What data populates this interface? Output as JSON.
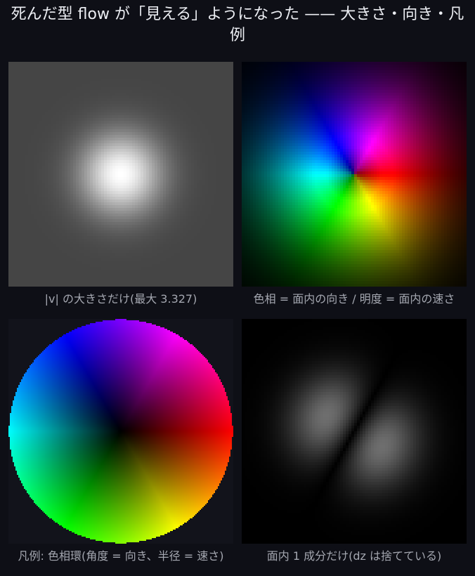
{
  "title": "死んだ型 flow が「見える」ようになった —— 大きさ・向き・凡例",
  "panels": [
    {
      "id": "magnitude",
      "image": "grayscale speed magnitude map of a centered vortex",
      "caption": "|v| の大きさだけ(最大 3.327)",
      "max_speed": 3.327
    },
    {
      "id": "hsv-flow",
      "image": "hue = in-plane direction, brightness = in-plane speed",
      "caption": "色相 = 面内の向き / 明度 = 面内の速さ"
    },
    {
      "id": "legend-wheel",
      "image": "hue wheel legend",
      "caption": "凡例: 色相環(角度 = 向き、半径 = 速さ)"
    },
    {
      "id": "single-component",
      "image": "grayscale single in-plane component",
      "caption": "面内 1 成分だけ(dz は捨てている)"
    }
  ],
  "colors": {
    "background": "#0e0f16",
    "title_text": "#eceef3",
    "caption_text": "#a4a7b0",
    "panel_background": "#12131b"
  }
}
